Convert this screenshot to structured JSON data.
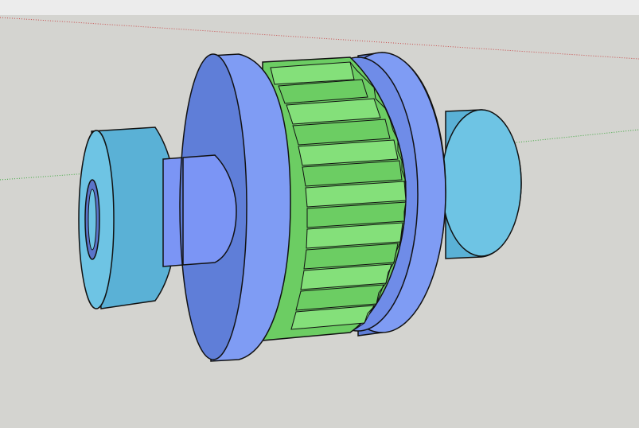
{
  "app": {
    "background_color": "#d4d4d0",
    "top_strip_color": "#ececec"
  },
  "scene": {
    "description_icon": "gear-shaft-model-icon",
    "colors": {
      "hub_light": "#6ec4e4",
      "hub_mid": "#5ab1d6",
      "shaft": "#7b95f5",
      "disc_face": "#5f7ed8",
      "disc_rim": "#7f9cf4",
      "gear_light": "#84e07a",
      "gear_mid": "#6ccd63",
      "gear_dark": "#4fb348",
      "outline": "#111111",
      "red_axis": "#c84a4a",
      "green_axis": "#3fa83f"
    }
  }
}
